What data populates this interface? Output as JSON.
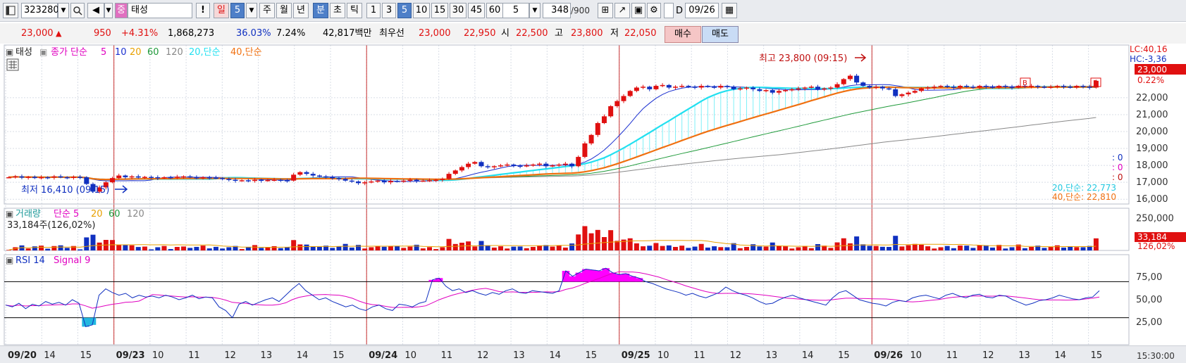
{
  "toolbar": {
    "code": "323280",
    "stock_name": "태성",
    "stock_badge": "중",
    "period_day": "일",
    "period_day_n": "5",
    "period_week": "주",
    "period_month": "월",
    "period_year": "년",
    "period_minute": "분",
    "period_second": "초",
    "period_tick": "틱",
    "intervals": [
      "1",
      "3",
      "5",
      "10",
      "15",
      "30",
      "45",
      "60"
    ],
    "selected_interval": "5",
    "interval_select": "5",
    "count": "348",
    "count_max": "/900",
    "d_label": "D",
    "date": "09/26",
    "alert": "!"
  },
  "info": {
    "price": "23,000",
    "change": "950",
    "change_pct": "+4.31%",
    "volume": "1,868,273",
    "pct2": "36.03%",
    "pct3": "7.24%",
    "amount": "42,817백만",
    "best_ask_label": "최우선",
    "best_ask": "23,000",
    "best_bid": "22,950",
    "open_label": "시",
    "open": "22,500",
    "high_label": "고",
    "high": "23,800",
    "low_label": "저",
    "low": "22,050",
    "buy": "매수",
    "sell": "매도"
  },
  "legend": {
    "price_name": "태성",
    "price_indicator": "종가 단순",
    "ma": [
      "5",
      "10",
      "20",
      "60",
      "120"
    ],
    "ma_colors": [
      "#e000c0",
      "#1a2fd0",
      "#e8a000",
      "#1f9a3a",
      "#888888"
    ],
    "ma20_label": "20,단순",
    "ma40_label": "40,단순",
    "ma20_color": "#22e0f0",
    "ma40_color": "#f07010"
  },
  "annotations": {
    "high_text": "최고 23,800 (09:15)",
    "low_text": "최저 16,410 (09:15)",
    "lc": "LC:40,16",
    "hc": "HC:-3,36",
    "price_tag": "23,000",
    "price_pct": "0.22%",
    "b_marker": "B",
    "side_zero": ": 0",
    "ma20_value": "20,단순: 22,773",
    "ma40_value": "40,단순: 22,810",
    "volume_title": "거래량",
    "volume_ma": "단순 5",
    "volume_ma_rest": [
      "20",
      "60",
      "120"
    ],
    "volume_value": "33,184주(126,02%)",
    "volume_tag": "33,184",
    "volume_pct": "126,02%",
    "rsi_title": "RSI 14",
    "rsi_signal": "Signal 9",
    "time_label": "15:30:00"
  },
  "colors": {
    "up": "#e01010",
    "down": "#1030c0",
    "grid": "#d8dde6",
    "day_line": "#c83030",
    "rsi_fill": "#ff00ff"
  },
  "chart_data": {
    "type": "candlestick",
    "interval_minutes": 5,
    "days": [
      "09/20",
      "09/23",
      "09/24",
      "09/25",
      "09/26"
    ],
    "x_ticks": [
      "09/20",
      "14",
      "15",
      "09/23",
      "10",
      "11",
      "12",
      "13",
      "14",
      "15",
      "09/24",
      "10",
      "11",
      "12",
      "13",
      "14",
      "15",
      "09/25",
      "10",
      "11",
      "12",
      "13",
      "14",
      "15",
      "09/26",
      "10",
      "11",
      "12",
      "13",
      "14",
      "15"
    ],
    "price_axis": [
      "16,000",
      "17,000",
      "18,000",
      "19,000",
      "20,000",
      "21,000",
      "22,000"
    ],
    "price_range": [
      15800,
      23950
    ],
    "close_series": [
      17300,
      17350,
      17280,
      17320,
      17250,
      17300,
      17280,
      17350,
      17300,
      17260,
      17320,
      17300,
      16900,
      16450,
      16700,
      17000,
      17250,
      17400,
      17300,
      17350,
      17280,
      17320,
      17300,
      17250,
      17300,
      17280,
      17330,
      17350,
      17300,
      17260,
      17300,
      17280,
      17250,
      17200,
      17150,
      17100,
      17120,
      17080,
      17150,
      17100,
      17130,
      17150,
      17120,
      17100,
      17450,
      17600,
      17500,
      17400,
      17350,
      17300,
      17250,
      17200,
      17100,
      17050,
      16950,
      17000,
      17050,
      17100,
      17000,
      17080,
      17050,
      17100,
      17150,
      17080,
      17100,
      17120,
      17150,
      17200,
      17500,
      17700,
      17900,
      18100,
      18200,
      17950,
      17900,
      17950,
      18000,
      18050,
      17980,
      17950,
      18000,
      18050,
      18100,
      17950,
      18000,
      18050,
      18100,
      17950,
      18500,
      19300,
      19800,
      20500,
      20900,
      21500,
      21800,
      22100,
      22400,
      22600,
      22650,
      22500,
      22700,
      22750,
      22600,
      22650,
      22700,
      22650,
      22600,
      22700,
      22650,
      22600,
      22700,
      22650,
      22500,
      22550,
      22600,
      22500,
      22400,
      22450,
      22300,
      22400,
      22450,
      22500,
      22550,
      22600,
      22650,
      22500,
      22550,
      22600,
      22800,
      23100,
      23300,
      22900,
      22700,
      22600,
      22650,
      22550,
      22500,
      22100,
      22200,
      22300,
      22400,
      22550,
      22600,
      22650,
      22700,
      22650,
      22600,
      22700,
      22650,
      22600,
      22700,
      22650,
      22600,
      22700,
      22650,
      22600,
      22700,
      22650,
      22700,
      22650,
      22600,
      22650,
      22700,
      22650,
      22600,
      22700,
      22650,
      22600,
      23000
    ],
    "high": 23800,
    "high_time": "09:15",
    "low": 16410,
    "low_time": "09:15",
    "volume_axis": [
      "250,000"
    ],
    "volume_range": [
      0,
      330000
    ],
    "volume_peaks": [
      {
        "day": "09/25",
        "value": 300000
      },
      {
        "day": "09/25",
        "value": 270000
      },
      {
        "day": "09/25",
        "value": 250000
      },
      {
        "day": "09/26",
        "value": 290000
      },
      {
        "day": "09/26",
        "value": 180000
      },
      {
        "day": "09/25",
        "value": 185000
      }
    ],
    "rsi_axis": [
      "75,00",
      "50,00",
      "25,00"
    ],
    "rsi_range": [
      0,
      100
    ],
    "rsi_levels": [
      70,
      30
    ],
    "rsi_series": [
      44,
      42,
      46,
      40,
      45,
      43,
      48,
      45,
      47,
      44,
      50,
      46,
      20,
      22,
      55,
      62,
      58,
      55,
      57,
      52,
      55,
      53,
      54,
      52,
      55,
      53,
      50,
      52,
      55,
      51,
      53,
      52,
      42,
      38,
      30,
      45,
      48,
      44,
      47,
      50,
      52,
      48,
      55,
      62,
      68,
      60,
      55,
      50,
      52,
      48,
      45,
      42,
      44,
      40,
      38,
      42,
      44,
      40,
      38,
      45,
      44,
      42,
      46,
      48,
      72,
      74,
      65,
      60,
      62,
      58,
      60,
      57,
      55,
      58,
      56,
      60,
      62,
      58,
      57,
      60,
      59,
      58,
      57,
      60,
      82,
      76,
      80,
      84,
      83,
      82,
      85,
      80,
      78,
      79,
      76,
      74,
      70,
      68,
      65,
      62,
      60,
      58,
      55,
      57,
      54,
      52,
      55,
      58,
      64,
      60,
      57,
      55,
      52,
      48,
      45,
      46,
      50,
      53,
      55,
      52,
      50,
      48,
      46,
      44,
      52,
      58,
      60,
      55,
      50,
      48,
      46,
      45,
      43,
      47,
      49,
      48,
      52,
      54,
      55,
      53,
      51,
      55,
      57,
      54,
      52,
      55,
      56,
      53,
      52,
      55,
      54,
      50,
      47,
      44,
      46,
      49,
      50,
      52,
      55,
      53,
      51,
      50,
      52,
      53,
      60
    ],
    "ma20_value": 22773,
    "ma40_value": 22810
  }
}
